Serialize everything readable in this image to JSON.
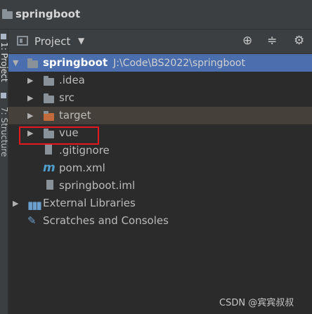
{
  "window": {
    "title": "springboot"
  },
  "side_tabs": {
    "project": "1: Project",
    "structure": "7: Structure"
  },
  "panel": {
    "label": "Project",
    "icons": [
      "crosshair-icon",
      "collapse-icon",
      "gear-icon"
    ]
  },
  "tree": {
    "root": {
      "label": "springboot",
      "path": "J:\\Code\\BS2022\\springboot"
    },
    "items": [
      {
        "label": ".idea",
        "icon": "folder-icon"
      },
      {
        "label": "src",
        "icon": "folder-icon"
      },
      {
        "label": "target",
        "icon": "folder-orange-icon"
      },
      {
        "label": "vue",
        "icon": "folder-icon"
      },
      {
        "label": ".gitignore",
        "icon": "gitignore-file-icon"
      },
      {
        "label": "pom.xml",
        "icon": "maven-icon"
      },
      {
        "label": "springboot.iml",
        "icon": "iml-file-icon"
      }
    ],
    "external": {
      "label": "External Libraries"
    },
    "scratches": {
      "label": "Scratches and Consoles"
    }
  },
  "colors": {
    "selection": "#4b6eaf",
    "annotation": "#e3191f",
    "target_folder": "#c36b3c"
  },
  "watermark": "CSDN @宾宾叔叔"
}
